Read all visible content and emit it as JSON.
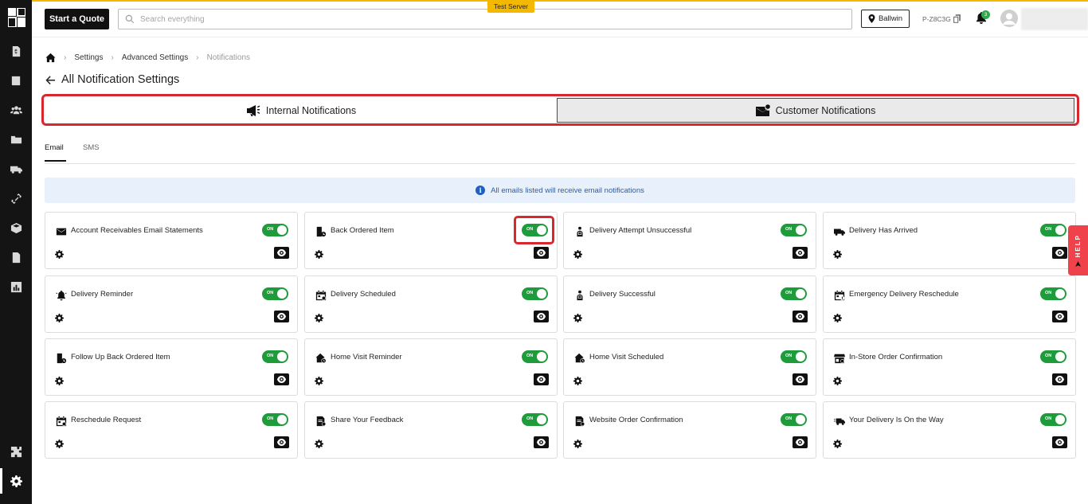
{
  "header": {
    "quote_button": "Start a Quote",
    "search_placeholder": "Search everything",
    "server_tag": "Test Server",
    "location": "Ballwin",
    "store_id": "P-Z8C3G",
    "notification_count": "3"
  },
  "breadcrumb": [
    "Settings",
    "Advanced Settings",
    "Notifications"
  ],
  "page_title": "All Notification Settings",
  "channels": {
    "internal": "Internal Notifications",
    "customer": "Customer Notifications",
    "selected": "customer"
  },
  "subtabs": {
    "email": "Email",
    "sms": "SMS",
    "selected": "email"
  },
  "info_message": "All emails listed will receive email notifications",
  "toggle_label": "ON",
  "cards": [
    {
      "title": "Account Receivables Email Statements",
      "icon": "envelope-icon",
      "enabled": true
    },
    {
      "title": "Back Ordered Item",
      "icon": "box-clock-icon",
      "enabled": true
    },
    {
      "title": "Delivery Attempt Unsuccessful",
      "icon": "person-package-icon",
      "enabled": true
    },
    {
      "title": "Delivery Has Arrived",
      "icon": "truck-icon",
      "enabled": true
    },
    {
      "title": "Delivery Reminder",
      "icon": "bell-ringing-icon",
      "enabled": true
    },
    {
      "title": "Delivery Scheduled",
      "icon": "calendar-icon",
      "enabled": true
    },
    {
      "title": "Delivery Successful",
      "icon": "person-package-icon",
      "enabled": true
    },
    {
      "title": "Emergency Delivery Reschedule",
      "icon": "calendar-alert-icon",
      "enabled": true
    },
    {
      "title": "Follow Up Back Ordered Item",
      "icon": "box-clock-icon",
      "enabled": true
    },
    {
      "title": "Home Visit Reminder",
      "icon": "house-clock-icon",
      "enabled": true
    },
    {
      "title": "Home Visit Scheduled",
      "icon": "house-clock-icon",
      "enabled": true
    },
    {
      "title": "In-Store Order Confirmation",
      "icon": "store-icon",
      "enabled": true
    },
    {
      "title": "Reschedule Request",
      "icon": "calendar-icon",
      "enabled": true
    },
    {
      "title": "Share Your Feedback",
      "icon": "document-feedback-icon",
      "enabled": true
    },
    {
      "title": "Website Order Confirmation",
      "icon": "document-check-icon",
      "enabled": true
    },
    {
      "title": "Your Delivery Is On the Way",
      "icon": "truck-moving-icon",
      "enabled": true
    }
  ],
  "help_label": "HELP"
}
